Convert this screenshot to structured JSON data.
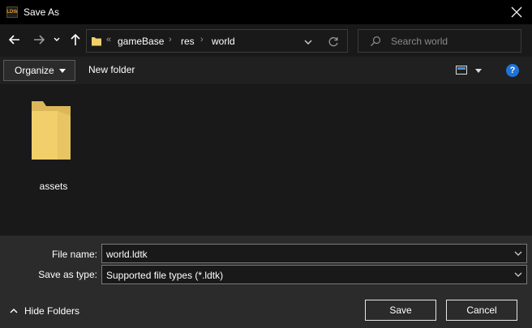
{
  "window": {
    "title": "Save As",
    "app_icon_text": "LDtk"
  },
  "nav": {
    "breadcrumb_overflow": "«",
    "breadcrumbs": [
      "gameBase",
      "res",
      "world"
    ],
    "separator": "›"
  },
  "search": {
    "placeholder": "Search world"
  },
  "toolbar": {
    "organize_label": "Organize",
    "new_folder_label": "New folder",
    "help_label": "?"
  },
  "content": {
    "items": [
      {
        "name": "assets",
        "type": "folder"
      }
    ]
  },
  "form": {
    "file_name_label": "File name:",
    "file_name_value": "world.ldtk",
    "save_type_label": "Save as type:",
    "save_type_value": "Supported file types (*.ldtk)"
  },
  "footer": {
    "hide_folders_label": "Hide Folders",
    "save_label": "Save",
    "cancel_label": "Cancel"
  },
  "colors": {
    "folder": "#f2cf6b",
    "accent": "#1e73d9",
    "background": "#191919"
  }
}
